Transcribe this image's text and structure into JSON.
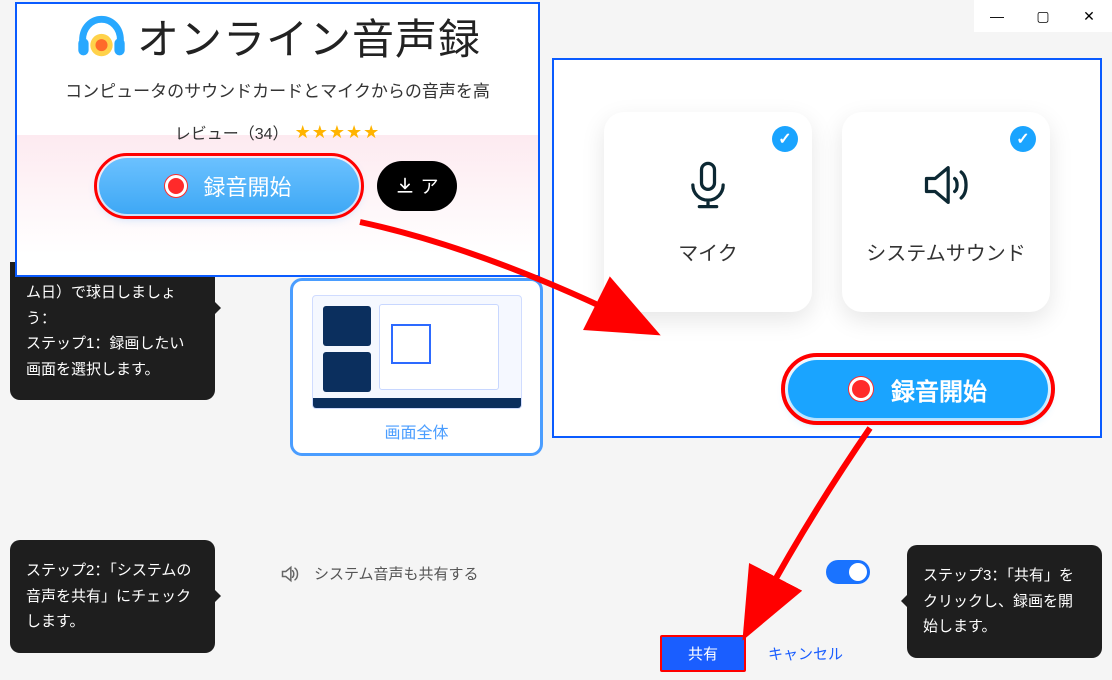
{
  "window": {
    "minimize": "—",
    "maximize": "▢",
    "close": "✕"
  },
  "top_panel": {
    "title": "オンライン音声録",
    "subtitle": "コンピュータのサウンドカードとマイクからの音声を高",
    "review_label": "レビュー（34）",
    "stars": "★★★★★",
    "record_label": "録音開始",
    "download_label": "ア"
  },
  "right_panel": {
    "mic_label": "マイク",
    "sys_label": "システムサウンド",
    "record_label": "録音開始"
  },
  "screen_select": {
    "label": "画面全体"
  },
  "share": {
    "sys_audio_label": "システム音声も共有する",
    "share_btn": "共有",
    "cancel_btn": "キャンセル"
  },
  "tips": {
    "a": "ム日）で球日しましょう：\nステップ1：録画したい画面を選択します。",
    "a_line1": "ム日）で球日しましょう：",
    "a_line2": "ステップ1：録画したい画面を選択します。",
    "b": "ステップ2：「システムの音声を共有」にチェックします。",
    "c": "ステップ3：「共有」をクリックし、録画を開始します。"
  }
}
